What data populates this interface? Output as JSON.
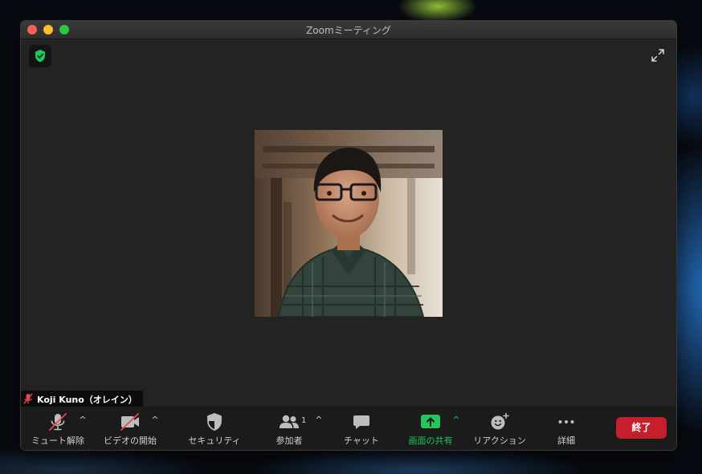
{
  "window": {
    "title": "Zoomミーティング"
  },
  "participant": {
    "name": "Koji Kuno（オレイン）",
    "count": "1"
  },
  "toolbar": {
    "mute_label": "ミュート解除",
    "video_label": "ビデオの開始",
    "security_label": "セキュリティ",
    "participants_label": "参加者",
    "chat_label": "チャット",
    "share_label": "画面の共有",
    "reactions_label": "リアクション",
    "more_label": "詳細",
    "end_label": "終了"
  },
  "colors": {
    "share_accent": "#22c55e",
    "end_button": "#c41f2a",
    "muted_red": "#e5484d",
    "secure_green": "#22c55e"
  },
  "icons": {
    "mute": "microphone-muted-icon",
    "video": "video-off-icon",
    "security": "shield-icon",
    "participants": "people-icon",
    "chat": "chat-bubble-icon",
    "share": "share-screen-icon",
    "reactions": "emoji-add-icon",
    "more": "more-dots-icon"
  }
}
